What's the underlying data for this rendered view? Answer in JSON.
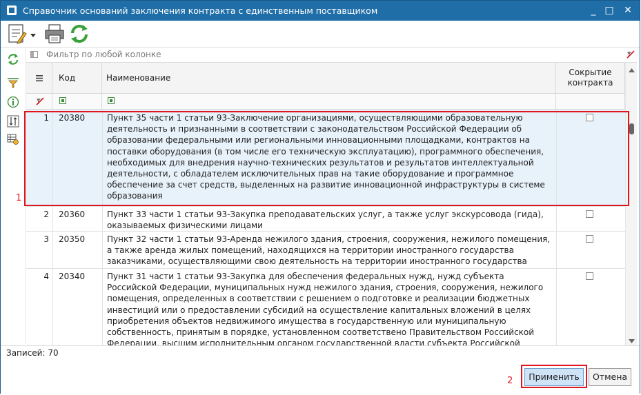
{
  "window": {
    "title": "Справочник оснований заключения контракта с единственным поставщиком",
    "minimize_glyph": "_",
    "maximize_glyph": "□",
    "close_glyph": "✕"
  },
  "filter": {
    "placeholder": "Фильтр по любой колонке"
  },
  "columns": {
    "code": "Код",
    "name": "Наименование",
    "hide_line1": "Сокрытие",
    "hide_line2": "контракта"
  },
  "rows": [
    {
      "num": "1",
      "code": "20380",
      "name": "Пункт 35 части 1 статьи 93-Заключение организациями, осуществляющими образовательную деятельность и признанными в соответствии с законодательством Российской Федерации об образовании федеральными или региональными инновационными площадками, контрактов на поставки оборудования (в том числе его техническую эксплуатацию), программного обеспечения, необходимых для внедрения научно-технических результатов и результатов интеллектуальной деятельности, с обладателем исключительных прав на такие оборудование и программное обеспечение за счет средств, выделенных на развитие инновационной инфраструктуры в системе образования",
      "hidden": false
    },
    {
      "num": "2",
      "code": "20360",
      "name": "Пункт 33 части 1 статьи 93-Закупка преподавательских услуг, а также услуг экскурсовода (гида), оказываемых физическими лицами",
      "hidden": false
    },
    {
      "num": "3",
      "code": "20350",
      "name": "Пункт 32 части 1 статьи 93-Аренда нежилого здания, строения, сооружения, нежилого помещения, а также аренда жилых помещений, находящихся на территории иностранного государства заказчиками, осуществляющими свою деятельность на территории иностранного государства",
      "hidden": false
    },
    {
      "num": "4",
      "code": "20340",
      "name": "Пункт 31 части 1 статьи 93-Закупка для обеспечения федеральных нужд, нужд субъекта Российской Федерации, муниципальных нужд нежилого здания, строения, сооружения, нежилого помещения, определенных в соответствии с решением о подготовке и реализации бюджетных инвестиций или о предоставлении субсидий на осуществление капитальных вложений в целях приобретения объектов недвижимого имущества в государственную или муниципальную собственность, принятым в порядке, установленном соответствено Правительством Российской Федерации, высшим исполнительным органом государственной власти субъекта Российской Федерации, местной администрацией",
      "hidden": false
    }
  ],
  "footer": {
    "records": "Записей: 70",
    "apply": "Применить",
    "cancel": "Отмена"
  },
  "annotations": {
    "mark1": "1",
    "mark2": "2"
  },
  "colors": {
    "titlebar": "#1f6ea8",
    "highlight": "#e0161e",
    "selected_row": "#e8f2fb"
  }
}
